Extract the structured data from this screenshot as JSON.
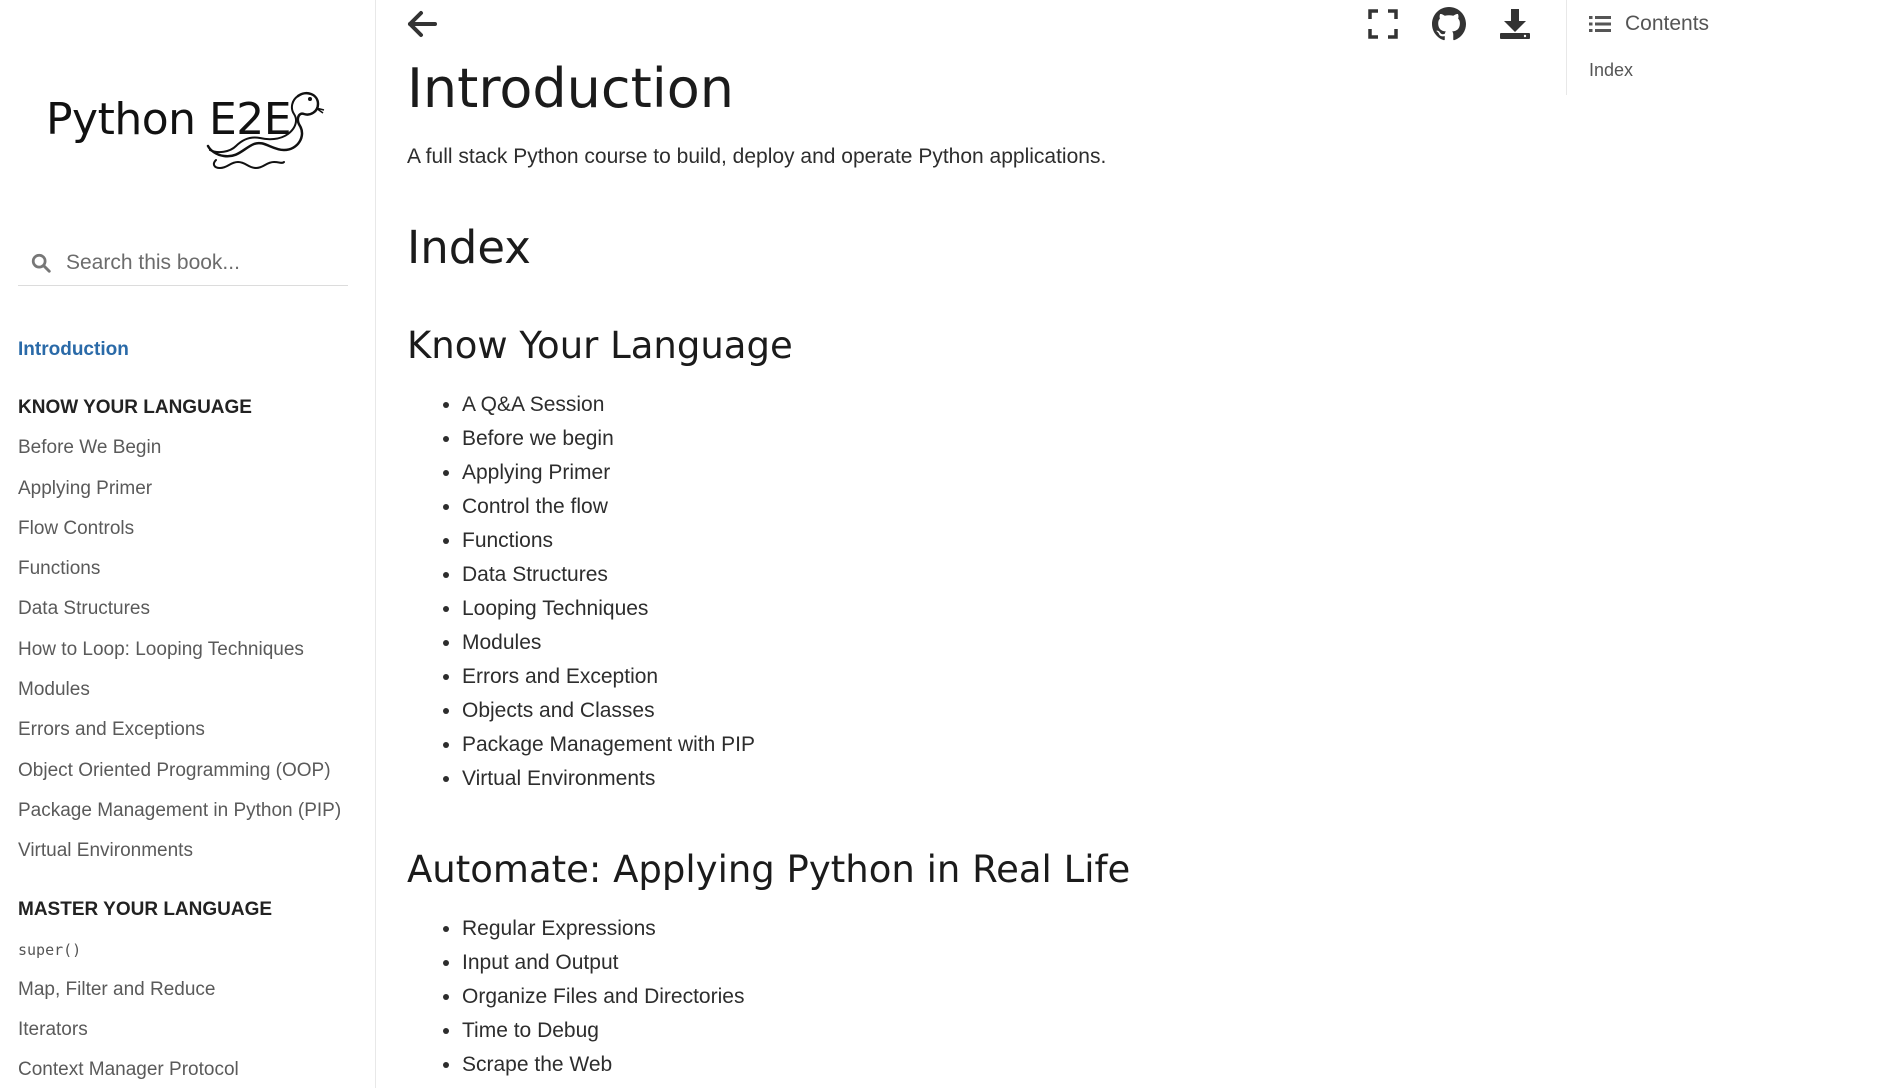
{
  "sidebar": {
    "logo_text": "Python E2E",
    "search_placeholder": "Search this book...",
    "nav": {
      "intro": "Introduction",
      "section1_title": "Know Your Language",
      "section1_items": [
        "Before We Begin",
        "Applying Primer",
        "Flow Controls",
        "Functions",
        "Data Structures",
        "How to Loop: Looping Techniques",
        "Modules",
        "Errors and Exceptions",
        "Object Oriented Programming (OOP)",
        "Package Management in Python (PIP)",
        "Virtual Environments"
      ],
      "section2_title": "Master Your Language",
      "section2_items": [
        "super()",
        "Map, Filter and Reduce",
        "Iterators",
        "Context Manager Protocol"
      ]
    }
  },
  "toolbar": {
    "icons": [
      "back-arrow-icon",
      "fullscreen-icon",
      "github-icon",
      "download-icon"
    ]
  },
  "toc": {
    "header": "Contents",
    "items": [
      "Index"
    ]
  },
  "main": {
    "title": "Introduction",
    "lead": "A full stack Python course to build, deploy and operate Python applications.",
    "index_title": "Index",
    "sections": [
      {
        "title": "Know Your Language",
        "items": [
          "A Q&A Session",
          "Before we begin",
          "Applying Primer",
          "Control the flow",
          "Functions",
          "Data Structures",
          "Looping Techniques",
          "Modules",
          "Errors and Exception",
          "Objects and Classes",
          "Package Management with PIP",
          "Virtual Environments"
        ]
      },
      {
        "title": "Automate: Applying Python in Real Life",
        "items": [
          "Regular Expressions",
          "Input and Output",
          "Organize Files and Directories",
          "Time to Debug",
          "Scrape the Web"
        ]
      }
    ]
  },
  "colors": {
    "active_link": "#2a6aa8",
    "text": "#2d2d2d",
    "muted": "#5a5a5a"
  }
}
